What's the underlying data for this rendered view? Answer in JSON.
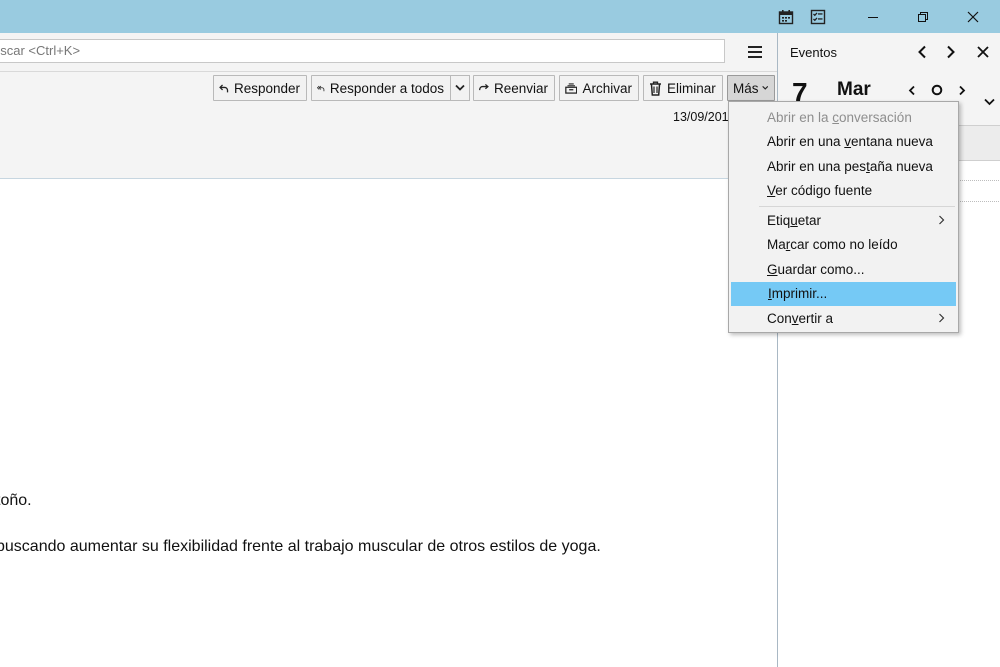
{
  "titlebar": {
    "icons": [
      "calendar-icon",
      "tasks-icon"
    ],
    "window_controls": [
      "minimize-icon",
      "restore-icon",
      "close-icon"
    ]
  },
  "search": {
    "placeholder_visible": "uscar <Ctrl+K>"
  },
  "toolbar": {
    "reply": "Responder",
    "reply_all": "Responder a todos",
    "forward": "Reenviar",
    "archive": "Archivar",
    "delete": "Eliminar",
    "more": "Más"
  },
  "message": {
    "date": "13/09/201",
    "body_lines": [
      "toño.",
      "buscando aumentar su flexibilidad frente al trabajo muscular de otros estilos de yoga."
    ]
  },
  "events": {
    "title": "Eventos",
    "day": "7",
    "month": "Mar"
  },
  "menu": {
    "items": [
      {
        "pre": "Abrir en la ",
        "u": "c",
        "post": "onversación",
        "disabled": true
      },
      {
        "pre": "Abrir en una ",
        "u": "v",
        "post": "entana nueva"
      },
      {
        "pre": "Abrir en una pes",
        "u": "t",
        "post": "aña nueva"
      },
      {
        "pre": "",
        "u": "V",
        "post": "er código fuente"
      },
      {
        "pre": "Etiq",
        "u": "u",
        "post": "etar",
        "submenu": true
      },
      {
        "pre": "Ma",
        "u": "r",
        "post": "car como no leído"
      },
      {
        "pre": "",
        "u": "G",
        "post": "uardar como..."
      },
      {
        "pre": "",
        "u": "I",
        "post": "mprimir...",
        "highlighted": true
      },
      {
        "pre": "Con",
        "u": "v",
        "post": "ertir a",
        "submenu": true
      }
    ]
  }
}
